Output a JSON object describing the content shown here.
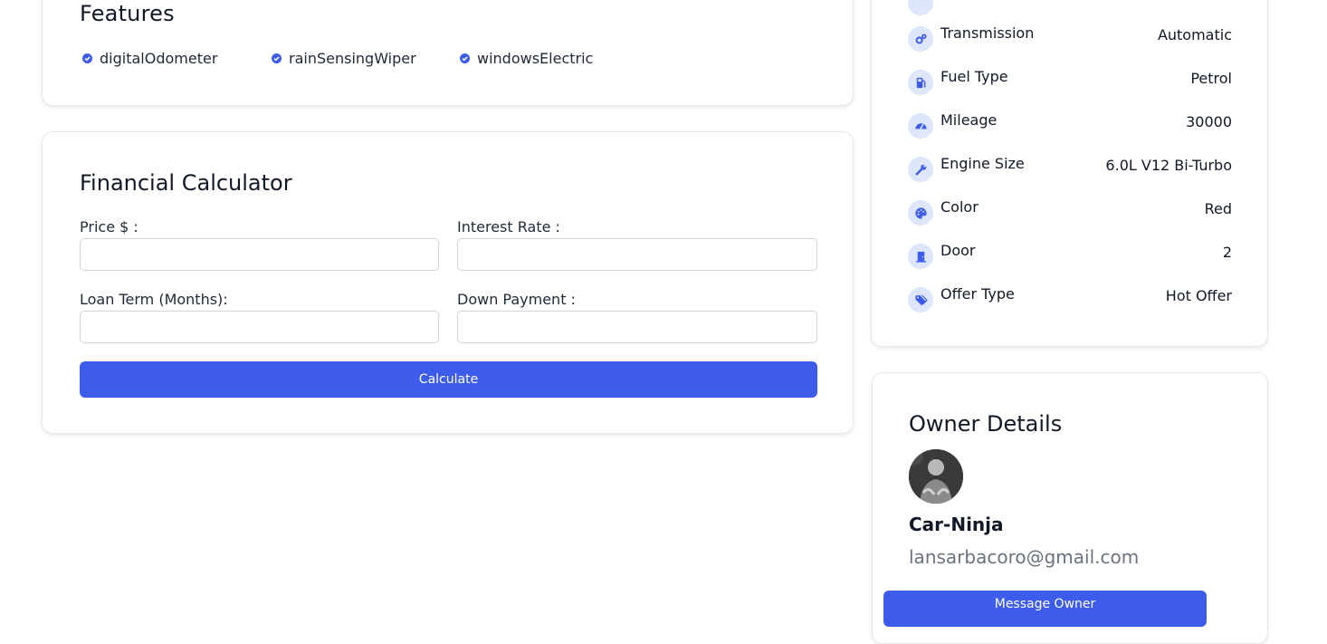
{
  "features": {
    "title": "Features",
    "items": [
      "digitalOdometer",
      "rainSensingWiper",
      "windowsElectric"
    ]
  },
  "calculator": {
    "title": "Financial Calculator",
    "price_label": "Price $ :",
    "interest_label": "Interest Rate :",
    "loan_term_label": "Loan Term (Months):",
    "down_payment_label": "Down Payment :",
    "price_value": "",
    "interest_value": "",
    "loan_term_value": "",
    "down_payment_value": "",
    "button_label": "Calculate"
  },
  "specs": [
    {
      "label": "Transmission",
      "value": "Automatic",
      "icon": "gears-icon"
    },
    {
      "label": "Fuel Type",
      "value": "Petrol",
      "icon": "gas-pump-icon"
    },
    {
      "label": "Mileage",
      "value": "30000",
      "icon": "gauge-icon"
    },
    {
      "label": "Engine Size",
      "value": "6.0L V12 Bi-Turbo",
      "icon": "wrench-icon"
    },
    {
      "label": "Color",
      "value": "Red",
      "icon": "palette-icon"
    },
    {
      "label": "Door",
      "value": "2",
      "icon": "door-icon"
    },
    {
      "label": "Offer Type",
      "value": "Hot Offer",
      "icon": "tag-icon"
    }
  ],
  "owner": {
    "title": "Owner Details",
    "name": "Car-Ninja",
    "email": "lansarbacoro@gmail.com",
    "button_label": "Message Owner"
  },
  "colors": {
    "accent": "#3d5cec",
    "icon_bg": "#dde6fb"
  }
}
